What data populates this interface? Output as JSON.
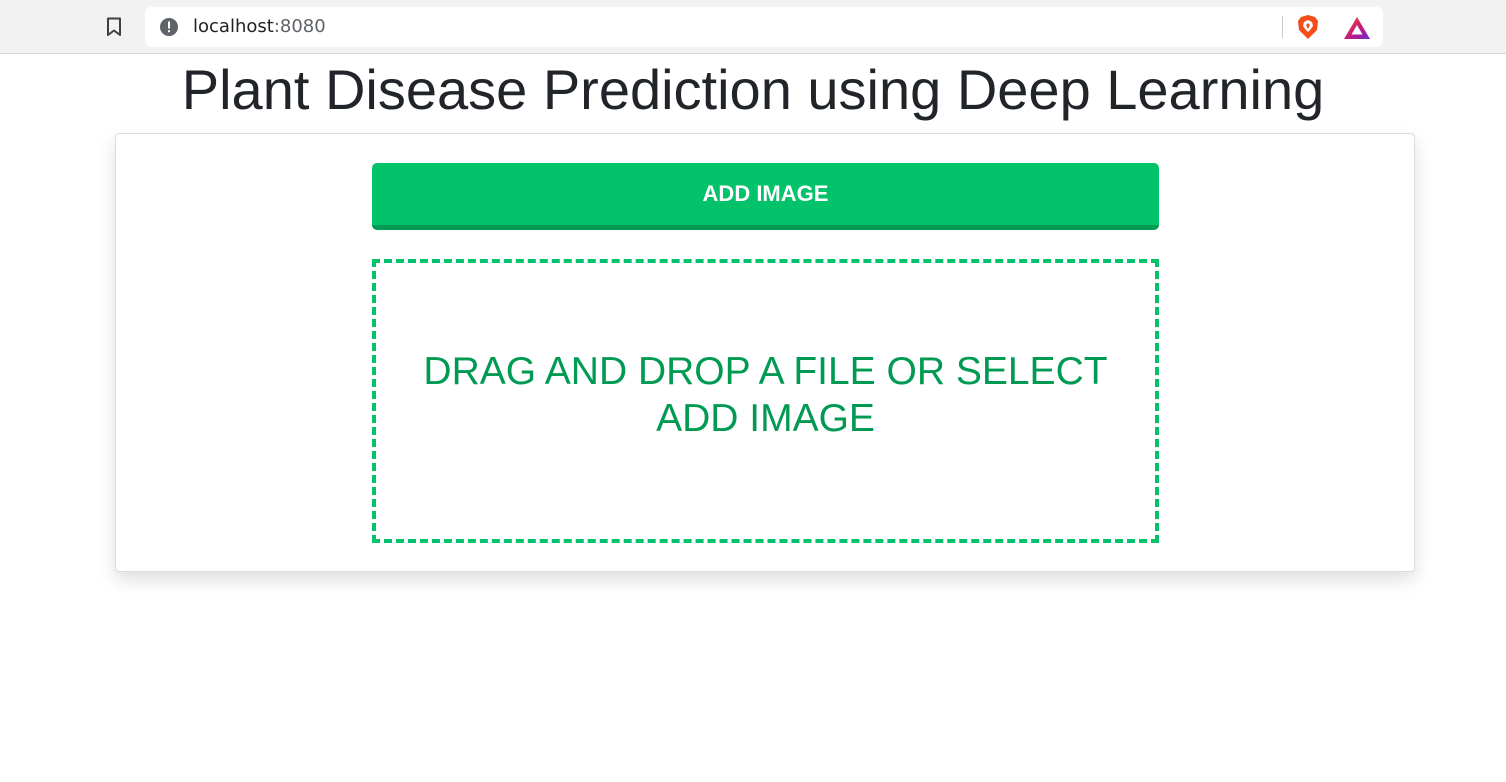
{
  "browser": {
    "url_host": "localhost",
    "url_port": ":8080"
  },
  "icons": {
    "bookmark": "bookmark-icon",
    "site_info": "info-icon",
    "shields": "brave-shields-icon",
    "rewards": "brave-rewards-icon"
  },
  "colors": {
    "accent": "#02c26a",
    "accent_dark": "#029a54",
    "drop_text": "#019a53",
    "title": "#212529"
  },
  "page": {
    "title": "Plant Disease Prediction using Deep Learning"
  },
  "uploader": {
    "button_label": "ADD IMAGE",
    "drop_text": "DRAG AND DROP A FILE OR SELECT ADD IMAGE"
  }
}
